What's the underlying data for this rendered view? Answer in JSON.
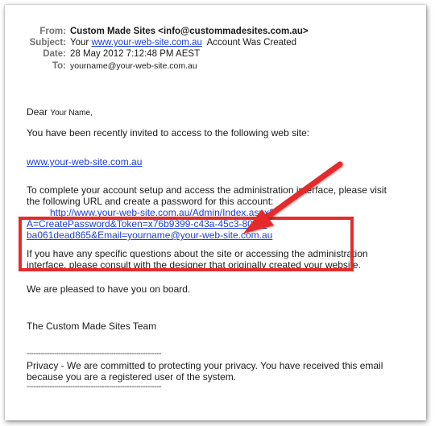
{
  "headers": {
    "from_label": "From:",
    "from_value": "Custom Made Sites <info@custommadesites.com.au>",
    "subject_label": "Subject:",
    "subject_prefix": "Your",
    "subject_link": "www.your-web-site.com.au",
    "subject_suffix": "Account Was Created",
    "date_label": "Date:",
    "date_value": "28 May 2012 7:12:48 PM AEST",
    "to_label": "To:",
    "to_value": "yourname@your-web-site.com.au"
  },
  "body": {
    "greeting": "Dear",
    "greeting_name": "Your Name,",
    "invite": "You have been recently invited to access to the following web site:",
    "site_link": "www.your-web-site.com.au",
    "setup_line1": "To complete your account setup and access the administration interface, please visit",
    "setup_line2": "the following URL and create a password for this account:",
    "url_line1": "http://www.your-web-site.com.au/Admin/Index.aspx?",
    "url_line2": "A=CreatePassword&Token=x76b9399-c43a-45c3-80a5-",
    "url_line3": "ba061dead865&Email=yourname@your-web-site.com.au",
    "questions_line1": "If you have any specific questions about the site or accessing the administration",
    "questions_line2": "interface, please consult with the designer that originally created your website.",
    "pleased": "We are pleased to have you on board.",
    "signature": "The Custom Made Sites Team",
    "divider": "-----------------------------------------------------------",
    "privacy_line1": "Privacy - We are committed to protecting your privacy. You have received this email",
    "privacy_line2": "because you are a registered user of the system."
  },
  "colors": {
    "link": "#1f3fd0",
    "annotation": "#e62b2b"
  },
  "icons": {
    "annotation_arrow": "red-arrow-icon"
  }
}
